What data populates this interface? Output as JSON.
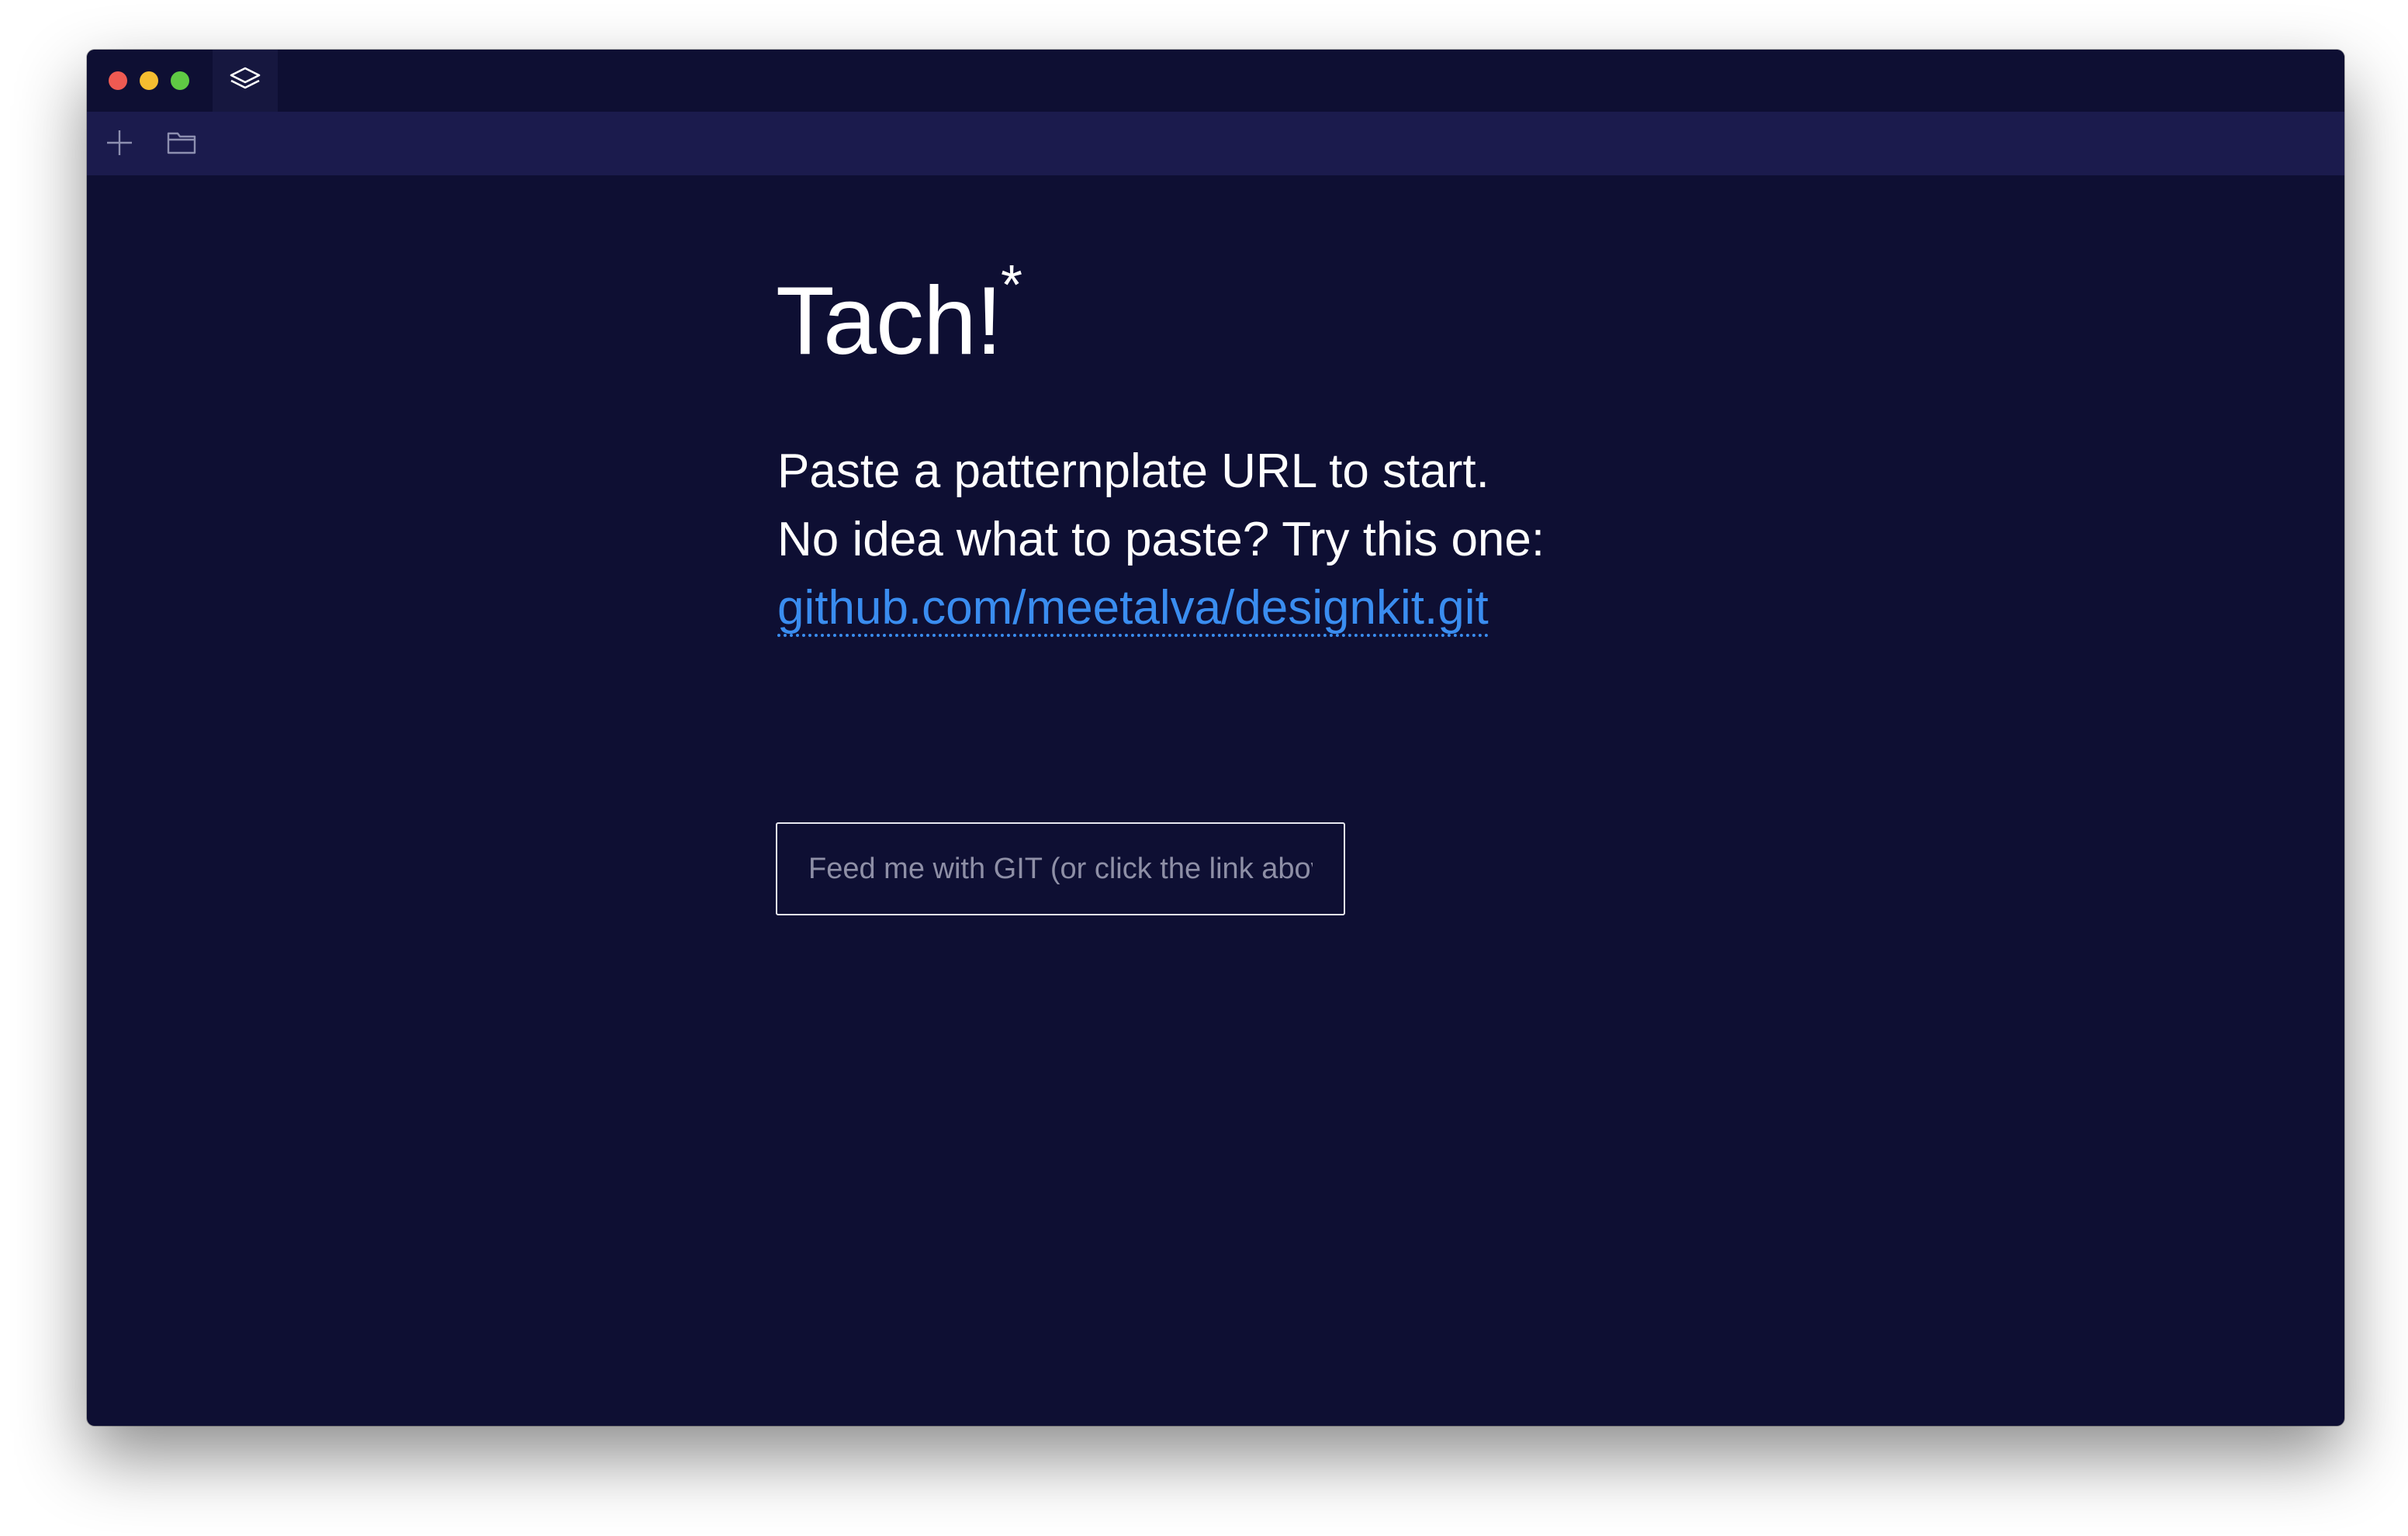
{
  "window": {
    "traffic_lights": {
      "close_color": "#ee5a52",
      "minimize_color": "#f5bd30",
      "maximize_color": "#5fca44"
    },
    "tab": {
      "icon": "layers-icon"
    }
  },
  "toolbar": {
    "new_icon": "plus-icon",
    "open_icon": "folder-icon"
  },
  "main": {
    "title": "Tach!",
    "title_sup": "*",
    "line1": "Paste a patternplate URL to start.",
    "line2": "No idea what to paste? Try this one:",
    "link_text": "github.com/meetalva/designkit.git",
    "input_placeholder": "Feed me with GIT (or click the link above)",
    "input_value": ""
  },
  "colors": {
    "background": "#0e0f33",
    "toolbar": "#1b1b4d",
    "link": "#3a8df0",
    "text": "#ffffff"
  }
}
